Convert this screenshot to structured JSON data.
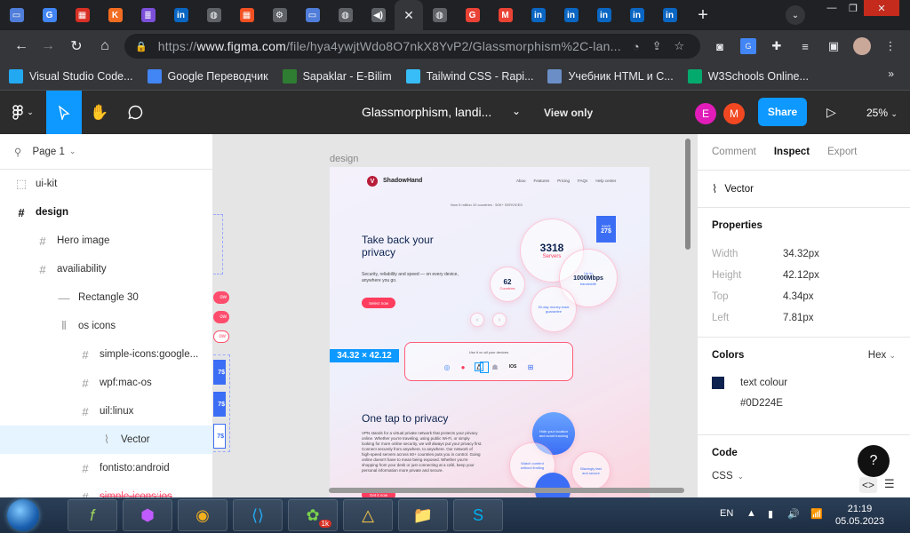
{
  "browser": {
    "tabs": [
      {
        "icon": "laptop-icon",
        "color": "#4f7dd9"
      },
      {
        "icon": "google-translate-icon",
        "color": "#4285f4"
      },
      {
        "icon": "red-app-icon",
        "color": "#d93025"
      },
      {
        "icon": "k-app-icon",
        "color": "#f26d21"
      },
      {
        "icon": "list-app-icon",
        "color": "#7b4fd9"
      },
      {
        "icon": "linkedin-icon",
        "color": "#0a66c2"
      },
      {
        "icon": "globe-icon",
        "color": "#5f6368"
      },
      {
        "icon": "microsoft-icon",
        "color": "#f25022"
      },
      {
        "icon": "settings-icon",
        "color": "#5f6368"
      },
      {
        "icon": "laptop-icon",
        "color": "#4f7dd9"
      },
      {
        "icon": "globe-icon",
        "color": "#5f6368"
      },
      {
        "icon": "audio-icon",
        "color": "#5f6368"
      },
      {
        "icon": "close-icon",
        "color": "#35363a"
      },
      {
        "icon": "globe-icon",
        "color": "#5f6368"
      },
      {
        "icon": "google-icon",
        "color": "#ea4335"
      },
      {
        "icon": "gmail-icon",
        "color": "#ea4335"
      },
      {
        "icon": "linkedin-icon",
        "color": "#0a66c2"
      },
      {
        "icon": "linkedin-icon",
        "color": "#0a66c2"
      },
      {
        "icon": "linkedin-icon",
        "color": "#0a66c2"
      },
      {
        "icon": "linkedin-icon",
        "color": "#0a66c2"
      },
      {
        "icon": "linkedin-icon",
        "color": "#0a66c2"
      }
    ],
    "url_prefix": "https://",
    "url_host": "www.figma.com",
    "url_path": "/file/hya4ywjtWdo8O7nkX8YvP2/Glassmorphism%2C-lan...",
    "bookmarks": [
      {
        "label": "Visual Studio Code...",
        "icon": "vscode-icon",
        "color": "#23a9f2"
      },
      {
        "label": "Google Переводчик",
        "icon": "google-translate-icon",
        "color": "#4285f4"
      },
      {
        "label": "Sapaklar - E-Bilim",
        "icon": "bilim-icon",
        "color": "#2e7d32"
      },
      {
        "label": "Tailwind CSS - Rapi...",
        "icon": "tailwind-icon",
        "color": "#38bdf8"
      },
      {
        "label": "Учебник HTML и С...",
        "icon": "htmlbook-icon",
        "color": "#6b8ec7"
      },
      {
        "label": "W3Schools Online...",
        "icon": "w3schools-icon",
        "color": "#04aa6d"
      }
    ]
  },
  "figma": {
    "file_title": "Glassmorphism, landi...",
    "view_only": "View only",
    "avatars": [
      {
        "letter": "E",
        "color": "#e11cb9"
      },
      {
        "letter": "M",
        "color": "#f24822"
      }
    ],
    "share_label": "Share",
    "zoom": "25%"
  },
  "left_panel": {
    "page_label": "Page 1",
    "layers": [
      {
        "label": "ui-kit",
        "icon": "dashed-frame-icon",
        "indent": 0,
        "bold": false,
        "selected": false
      },
      {
        "label": "design",
        "icon": "frame-icon",
        "indent": 0,
        "bold": true,
        "selected": false
      },
      {
        "label": "Hero image",
        "icon": "frame-icon",
        "indent": 1,
        "bold": false,
        "selected": false
      },
      {
        "label": "availiability",
        "icon": "frame-icon",
        "indent": 1,
        "bold": false,
        "selected": false
      },
      {
        "label": "Rectangle 30",
        "icon": "rectangle-icon",
        "indent": 2,
        "bold": false,
        "selected": false
      },
      {
        "label": "os icons",
        "icon": "autolayout-icon",
        "indent": 2,
        "bold": false,
        "selected": false
      },
      {
        "label": "simple-icons:google...",
        "icon": "frame-icon",
        "indent": 3,
        "bold": false,
        "selected": false
      },
      {
        "label": "wpf:mac-os",
        "icon": "frame-icon",
        "indent": 3,
        "bold": false,
        "selected": false
      },
      {
        "label": "uil:linux",
        "icon": "frame-icon",
        "indent": 3,
        "bold": false,
        "selected": false
      },
      {
        "label": "Vector",
        "icon": "vector-icon",
        "indent": 4,
        "bold": false,
        "selected": true
      },
      {
        "label": "fontisto:android",
        "icon": "frame-icon",
        "indent": 3,
        "bold": false,
        "selected": false
      },
      {
        "label": "simple-icons:ios",
        "icon": "frame-icon",
        "indent": 3,
        "bold": false,
        "selected": false
      }
    ]
  },
  "canvas": {
    "frame_label": "design",
    "measure_label": "34.32 × 42.12",
    "ghost_pill_text": "ow",
    "ghost_tag_text": "7$",
    "mockup": {
      "brand": "ShadowHand",
      "nav": [
        "Abou",
        "Features",
        "Pricing",
        "FAQs",
        "Help center"
      ],
      "tiny_line": "Now 5 million 10 countries  ·  50K+ SERVICES",
      "h1": "Take back your privacy",
      "para": "Security, reliability and speed — on every device, anywhere you go.",
      "cta": "Select now",
      "servers_num": "3318",
      "servers_label": "Servers",
      "countries_num": "62",
      "countries_label": "Countries",
      "speed_top": "Up to",
      "speed": "1000Mbps",
      "speed_bottom": "bandwidth",
      "guarantee": "30-day money-back guarantee",
      "save_label": "SAVE",
      "save_value": "27$",
      "os_title": "Use it on all your devices",
      "ios_label": "IOS",
      "h2": "One tap to privacy",
      "para2": "VPN stands for a virtual private network that protects your privacy online. Whether you're traveling, using public Wi-Fi, or simply looking for more online security, we will always put your privacy first. Connect securely from anywhere, to anywhere. Our network of high-speed servers across 60+ countries puts you in control. Going online doesn't have to mean being exposed. Whether you're shopping from your desk or just connecting at a café, keep your personal information more private and secure.",
      "bubble_a": "Hide your location and avoid tracking",
      "bubble_b": "Watch content without limiting",
      "bubble_c": "Browse anonymously",
      "bubble_d": "Blazingly fast and secure",
      "cta2": "Get it now"
    }
  },
  "right_panel": {
    "tabs": [
      "Comment",
      "Inspect",
      "Export"
    ],
    "active_tab": "Inspect",
    "layer_name": "Vector",
    "properties_title": "Properties",
    "properties": [
      {
        "key": "Width",
        "value": "34.32px"
      },
      {
        "key": "Height",
        "value": "42.12px"
      },
      {
        "key": "Top",
        "value": "4.34px"
      },
      {
        "key": "Left",
        "value": "7.81px"
      }
    ],
    "colors_title": "Colors",
    "color_format": "Hex",
    "color_name": "text colour",
    "color_value": "#0D224E",
    "code_title": "Code",
    "code_lang": "CSS",
    "help": "?"
  },
  "taskbar": {
    "apps": [
      {
        "icon": "formula-app-icon"
      },
      {
        "icon": "affinity-icon"
      },
      {
        "icon": "chrome-icon"
      },
      {
        "icon": "vscode-icon"
      },
      {
        "icon": "icq-icon"
      },
      {
        "icon": "google-drive-icon"
      },
      {
        "icon": "file-explorer-icon"
      },
      {
        "icon": "skype-icon"
      }
    ],
    "icq_badge": "1k",
    "lang": "EN",
    "time": "21:19",
    "date": "05.05.2023"
  }
}
